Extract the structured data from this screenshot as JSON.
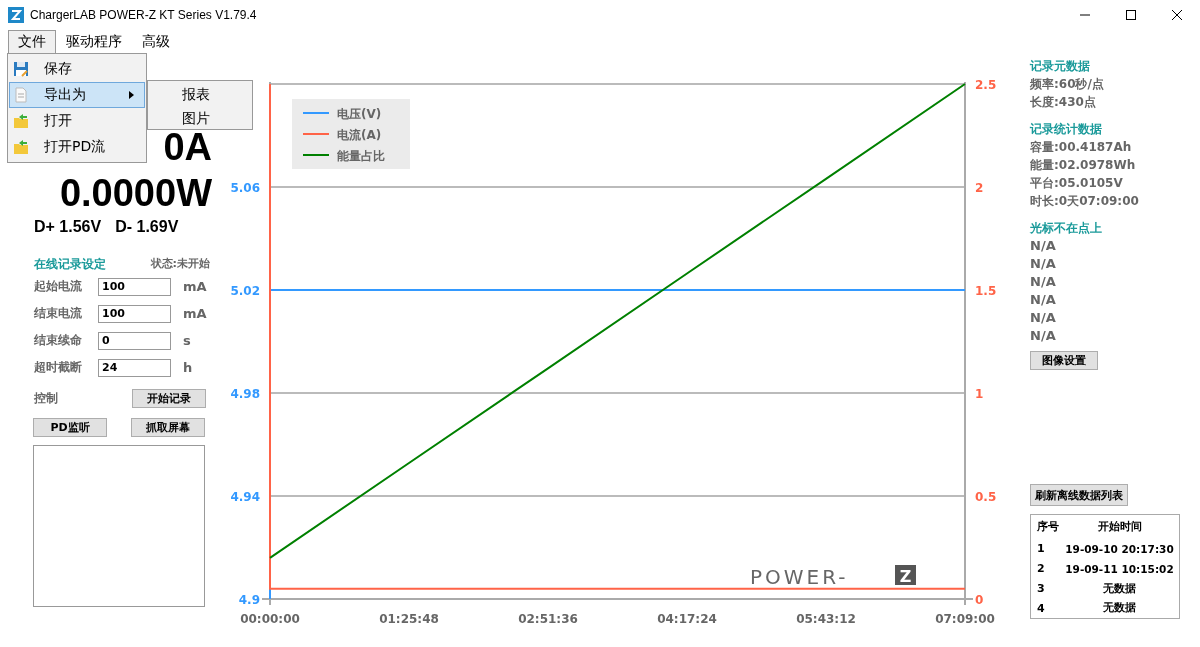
{
  "window": {
    "title": "ChargerLAB POWER-Z KT Series V1.79.4"
  },
  "menu_bar": [
    {
      "label": "文件",
      "selected": true
    },
    {
      "label": "驱动程序",
      "selected": false
    },
    {
      "label": "高级",
      "selected": false
    }
  ],
  "file_menu": [
    {
      "label": "保存",
      "kind": "save",
      "selected": false,
      "submenu": false
    },
    {
      "label": "导出为",
      "kind": "document",
      "selected": true,
      "submenu": true
    },
    {
      "label": "打开",
      "kind": "folder",
      "selected": false,
      "submenu": false
    },
    {
      "label": "打开PD流",
      "kind": "folder",
      "selected": false,
      "submenu": false
    }
  ],
  "export_submenu": [
    "报表",
    "图片"
  ],
  "readings": {
    "current": "0A",
    "power": "0.0000W",
    "d_plus": "D+ 1.56V",
    "d_minus": "D- 1.69V"
  },
  "online_record": {
    "title": "在线记录设定",
    "status": "状态:未开始",
    "fields": [
      {
        "label": "起始电流",
        "value": "100",
        "unit": "mA"
      },
      {
        "label": "结束电流",
        "value": "100",
        "unit": "mA"
      },
      {
        "label": "结束续命",
        "value": "0",
        "unit": "s"
      },
      {
        "label": "超时截断",
        "value": "24",
        "unit": "h"
      }
    ],
    "control_label": "控制",
    "buttons": [
      "开始记录",
      "PD监听",
      "抓取屏幕"
    ]
  },
  "chart": {
    "logo": "POWER-",
    "logo_mark": "Z",
    "chart_data": {
      "type": "line",
      "grid": true,
      "legend": "upper left",
      "x": [
        0,
        1,
        5148,
        10296,
        15444,
        20592,
        25740
      ],
      "xticks": [
        {
          "value": 0,
          "label": "00:00:00"
        },
        {
          "value": 5148,
          "label": "01:25:48"
        },
        {
          "value": 10296,
          "label": "02:51:36"
        },
        {
          "value": 15444,
          "label": "04:17:24"
        },
        {
          "value": 20592,
          "label": "05:43:12"
        },
        {
          "value": 25740,
          "label": "07:09:00"
        }
      ],
      "xlim": [
        0,
        25740
      ],
      "ylim": [
        4.9,
        5.1
      ],
      "yticks": [
        4.9,
        4.94,
        4.98,
        5.02,
        5.06
      ],
      "y2lim": [
        0,
        2.5
      ],
      "y2ticks": [
        0,
        0.5,
        1,
        1.5,
        2,
        2.5
      ],
      "series": [
        {
          "name": "电压(V)",
          "color": "#3399ff",
          "values": [
            4.9,
            5.02,
            5.02,
            5.02,
            5.02,
            5.02,
            5.02
          ]
        },
        {
          "name": "电流(A)",
          "color": "#ff6347",
          "axis": "y2",
          "values": [
            2.5,
            0.05,
            0.05,
            0.05,
            0.05,
            0.05,
            0.05
          ]
        },
        {
          "name": "能量占比",
          "color": "#008000",
          "axis": "y2",
          "values": [
            0.2,
            0.2,
            0.66,
            1.12,
            1.58,
            2.04,
            2.5
          ]
        }
      ]
    }
  },
  "record_meta": {
    "title": "记录元数据",
    "lines": [
      "频率:60秒/点",
      "长度:430点"
    ]
  },
  "record_stats": {
    "title": "记录统计数据",
    "lines": [
      "容量:00.4187Ah",
      "能量:02.0978Wh",
      "平台:05.0105V",
      "时长:0天07:09:00"
    ]
  },
  "cursor": {
    "title": "光标不在点上",
    "lines": [
      "N/A",
      "N/A",
      "N/A",
      "N/A",
      "N/A",
      "N/A"
    ]
  },
  "image_settings_button": "图像设置",
  "refresh_button": "刷新离线数据列表",
  "offline_table": {
    "columns": [
      "序号",
      "开始时间"
    ],
    "rows": [
      [
        "1",
        "19-09-10 20:17:30"
      ],
      [
        "2",
        "19-09-11 10:15:02"
      ],
      [
        "3",
        "无数据"
      ],
      [
        "4",
        "无数据"
      ]
    ]
  }
}
